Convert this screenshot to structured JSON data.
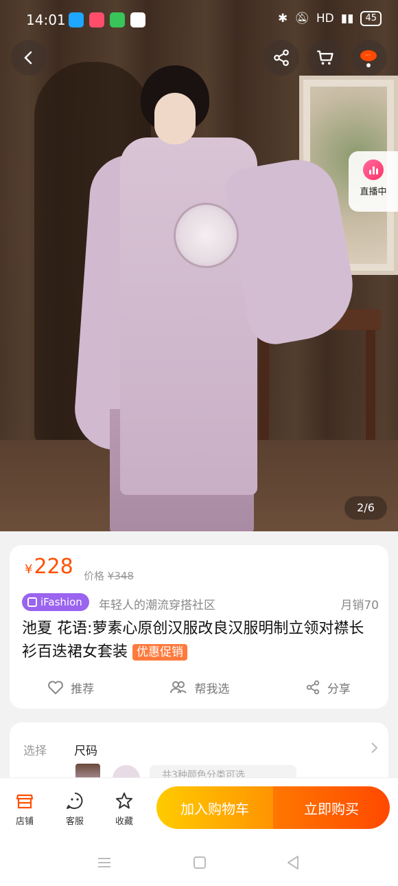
{
  "status": {
    "time": "14:01",
    "network": "HD",
    "battery": "45"
  },
  "colors": {
    "accent": "#ff5000",
    "brand_purple": "#9a63f0",
    "promo": "#ff7a3d",
    "cart_gradient": [
      "#ffcb00",
      "#ff9402"
    ],
    "buy_gradient": [
      "#ff7700",
      "#ff4900"
    ]
  },
  "header": {
    "icons": [
      "back-icon",
      "share-icon",
      "cart-icon",
      "more-icon"
    ]
  },
  "live": {
    "label": "直播中"
  },
  "gallery": {
    "pager": "2/6"
  },
  "product": {
    "currency": "¥",
    "price": "228",
    "orig_label": "价格",
    "orig_price": "¥348",
    "brand": "iFashion",
    "slogan": "年轻人的潮流穿搭社区",
    "monthly_sales": "月销70",
    "title": "池夏 花语:萝素心原创汉服改良汉服明制立领对襟长衫百迭裙女套装",
    "promo_badge": "优惠促销"
  },
  "actions": {
    "recommend": "推荐",
    "help_choose": "帮我选",
    "share": "分享"
  },
  "options": {
    "label": "选择",
    "value": "尺码",
    "hint": "共3种颜色分类可选"
  },
  "bottombar": {
    "store": "店铺",
    "service": "客服",
    "favorite": "收藏",
    "add_to_cart": "加入购物车",
    "buy_now": "立即购买"
  }
}
